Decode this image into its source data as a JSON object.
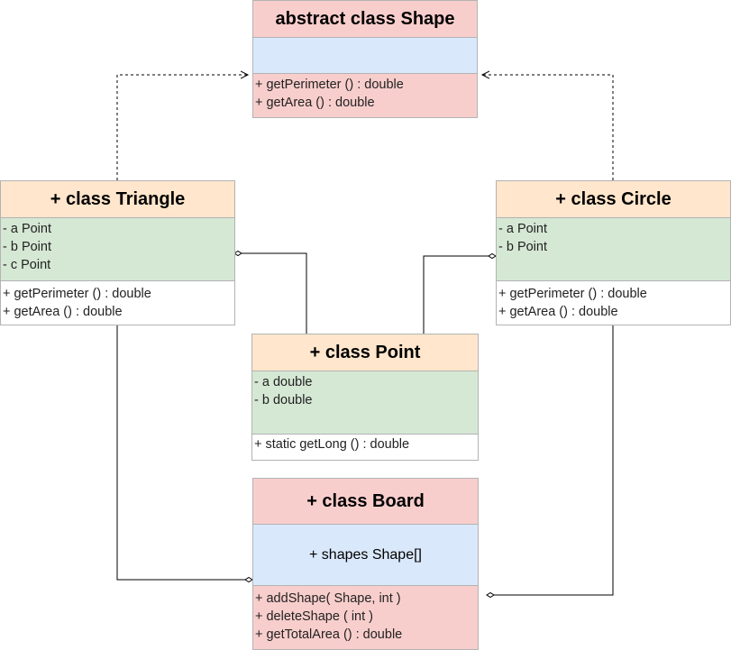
{
  "shape": {
    "title": "abstract class Shape",
    "methods": [
      "+ getPerimeter () : double",
      "+ getArea () : double"
    ]
  },
  "triangle": {
    "title": "+ class Triangle",
    "fields": [
      "- a Point",
      "- b Point",
      "- c Point"
    ],
    "methods": [
      "+ getPerimeter () : double",
      "+ getArea () : double"
    ]
  },
  "circle": {
    "title": "+ class Circle",
    "fields": [
      "- a Point",
      "- b Point"
    ],
    "methods": [
      "+ getPerimeter () : double",
      "+ getArea () : double"
    ]
  },
  "point": {
    "title": "+ class Point",
    "fields": [
      "- a double",
      "- b double"
    ],
    "methods": [
      "+ static getLong () : double"
    ]
  },
  "board": {
    "title": "+ class Board",
    "fields": [
      "+ shapes Shape[]"
    ],
    "methods": [
      "+ addShape( Shape, int )",
      "+ deleteShape ( int )",
      "+ getTotalArea () : double"
    ]
  },
  "colors": {
    "pink": "#f8cecc",
    "blue": "#dae8fc",
    "green": "#d5e8d4",
    "orange": "#ffe6cc",
    "border": "#b3b3b3"
  }
}
